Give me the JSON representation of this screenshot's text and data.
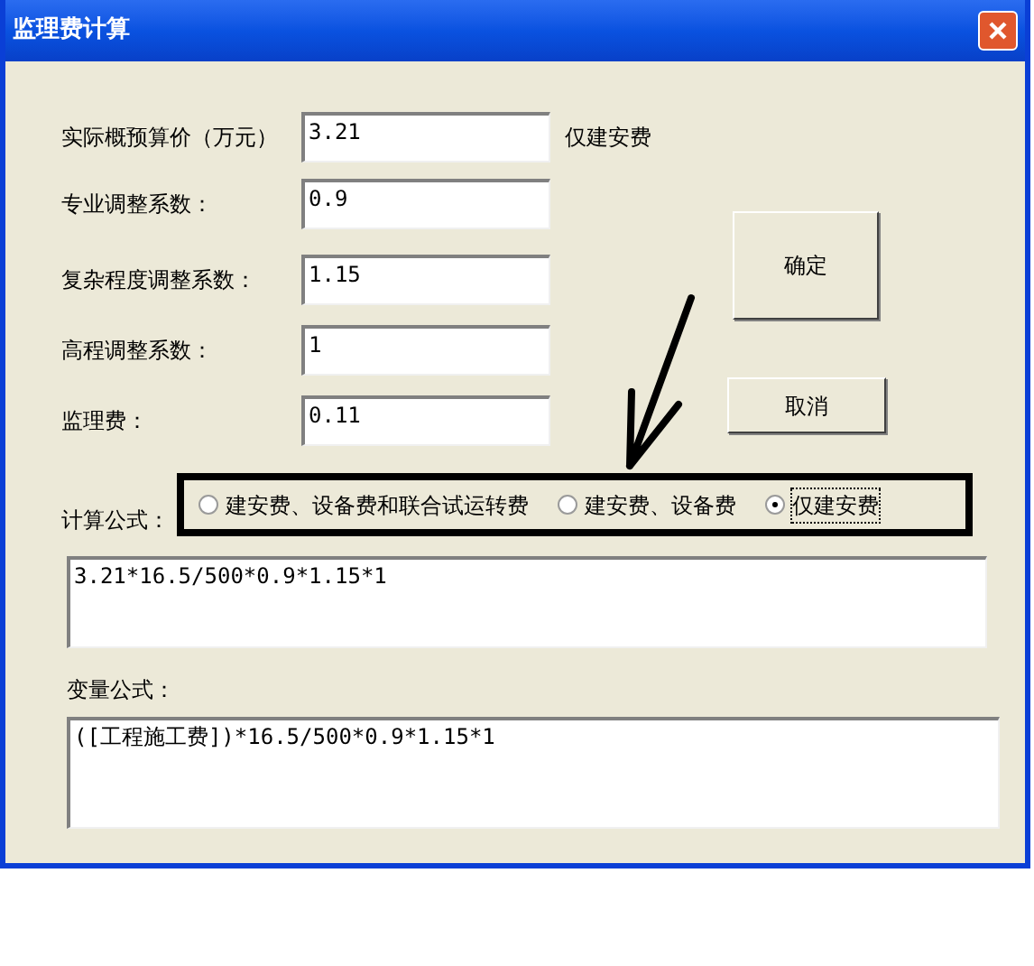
{
  "window": {
    "title": "监理费计算"
  },
  "fields": [
    {
      "label": "实际概预算价（万元）",
      "value": "3.21",
      "note": "仅建安费"
    },
    {
      "label": "专业调整系数：",
      "value": "0.9"
    },
    {
      "label": "复杂程度调整系数：",
      "value": "1.15"
    },
    {
      "label": "高程调整系数：",
      "value": "1"
    },
    {
      "label": "监理费：",
      "value": "0.11"
    }
  ],
  "buttons": [
    {
      "label": "确定",
      "kind": "large"
    },
    {
      "label": "取消",
      "kind": "small"
    }
  ],
  "formula": {
    "label": "计算公式：",
    "options": [
      {
        "label": "建安费、设备费和联合试运转费",
        "selected": false
      },
      {
        "label": "建安费、设备费",
        "selected": false
      },
      {
        "label": "仅建安费",
        "selected": true
      }
    ],
    "value": "3.21*16.5/500*0.9*1.15*1"
  },
  "variable_formula": {
    "label": "变量公式：",
    "value": "([工程施工费])*16.5/500*0.9*1.15*1"
  }
}
